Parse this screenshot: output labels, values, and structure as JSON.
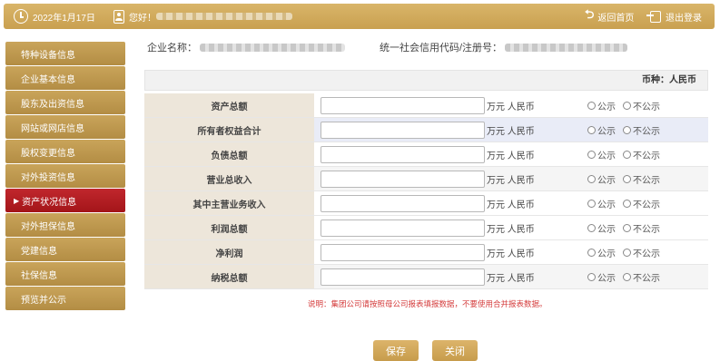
{
  "topbar": {
    "date": "2022年1月17日",
    "greeting": "您好！",
    "back_label": "返回首页",
    "logout_label": "退出登录"
  },
  "sidebar": {
    "items": [
      {
        "label": "特种设备信息"
      },
      {
        "label": "企业基本信息"
      },
      {
        "label": "股东及出资信息"
      },
      {
        "label": "网站或网店信息"
      },
      {
        "label": "股权变更信息"
      },
      {
        "label": "对外投资信息"
      },
      {
        "label": "资产状况信息",
        "active": true
      },
      {
        "label": "对外担保信息"
      },
      {
        "label": "党建信息"
      },
      {
        "label": "社保信息"
      },
      {
        "label": "预览并公示"
      }
    ]
  },
  "header": {
    "company_name_label": "企业名称：",
    "credit_code_label": "统一社会信用代码/注册号："
  },
  "currency_label": "币种：人民币",
  "table": {
    "rows": [
      {
        "label": "资产总额",
        "value": "",
        "unit": "万元 人民币"
      },
      {
        "label": "所有者权益合计",
        "value": "",
        "unit": "万元 人民币"
      },
      {
        "label": "负债总额",
        "value": "",
        "unit": "万元 人民币"
      },
      {
        "label": "营业总收入",
        "value": "",
        "unit": "万元 人民币"
      },
      {
        "label": "其中主营业务收入",
        "value": "",
        "unit": "万元 人民币"
      },
      {
        "label": "利润总额",
        "value": "",
        "unit": "万元 人民币"
      },
      {
        "label": "净利润",
        "value": "",
        "unit": "万元 人民币"
      },
      {
        "label": "纳税总额",
        "value": "",
        "unit": "万元 人民币"
      }
    ],
    "public_label": "公示",
    "private_label": "不公示"
  },
  "note": "说明：集团公司请按照母公司报表填报数据，不要使用合并报表数据。",
  "buttons": {
    "save_label": "保存",
    "close_label": "关闭"
  },
  "colors": {
    "gold": "#c9a050",
    "active_red": "#b31d22",
    "note_red": "#d43b3b"
  }
}
